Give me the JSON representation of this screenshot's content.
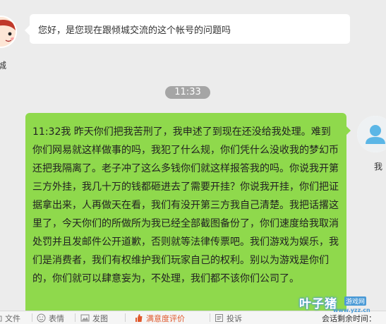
{
  "agent": {
    "name": "城",
    "message": "您好，是您现在跟倾城交流的这个帐号的问题吗"
  },
  "timestamp": "11:33",
  "user": {
    "name": "我",
    "message": "11:32我 昨天你们把我苦刑了，我申述了到现在还没给我处理。难到你们网易就这样做事的吗，我犯了什么规，你们凭什么没收我的梦幻币还把我隔离了。老子冲了这么多钱你们就这样报答我的吗。你说我开第三方外挂，我几十万的钱都砸进去了需要开挂？你说我开挂，你们把证据拿出来，人再做天在看，我们有没开第三方我自己清楚。我把话撂这里了，今天你们的所做所为我已经全部截图备份了，你们速度给我取消处罚并且发邮件公开道歉，否则就等法律传票吧。我们游戏为娱乐，我们是消费者，我们有权维护我们玩家自己的权利。别以为游戏是你们的，你们就可以肆意妄为，不处理，我们都不该你们公司了。"
  },
  "toolbar": {
    "items": [
      {
        "label": "文件",
        "icon": "folder-icon"
      },
      {
        "label": "表情",
        "icon": "smiley-icon"
      },
      {
        "label": "发图",
        "icon": "image-icon"
      },
      {
        "label": "满意度评价",
        "icon": "like-icon"
      },
      {
        "label": "投诉",
        "icon": "complaint-icon"
      }
    ],
    "right_text": "会话剩余时间："
  },
  "watermark": {
    "main": "叶子猪",
    "tag": "游戏网",
    "url": "www.yzz.cn"
  },
  "colors": {
    "user_bubble": "#8fd94c",
    "highlight": "#e0582b",
    "watermark": "#4a9ad6"
  }
}
